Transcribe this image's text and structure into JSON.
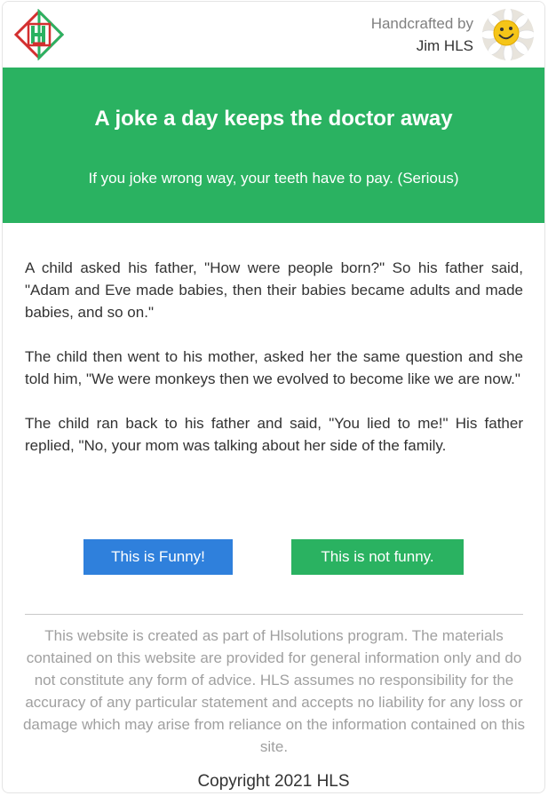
{
  "header": {
    "logo_icon": "hls-diamond-logo-icon",
    "credit_line1": "Handcrafted by",
    "credit_line2": "Jim HLS",
    "avatar_icon": "smiley-flower-avatar-icon"
  },
  "hero": {
    "title": "A joke a day keeps the doctor away",
    "subtitle": "If you joke wrong way, your teeth have to pay. (Serious)",
    "background_color": "#2ab261"
  },
  "joke": {
    "paragraphs": [
      "A child asked his father, \"How were people born?\" So his father said, \"Adam and Eve made babies, then their babies became adults and made babies, and so on.\"",
      "The child then went to his mother, asked her the same question and she told him, \"We were monkeys then we evolved to become like we are now.\"",
      "The child ran back to his father and said, \"You lied to me!\" His father replied, \"No, your mom was talking about her side of the family."
    ]
  },
  "buttons": {
    "funny_label": "This is Funny!",
    "funny_color": "#2f80dc",
    "not_funny_label": "This is not funny.",
    "not_funny_color": "#2ab261"
  },
  "footer": {
    "disclaimer": "This website is created as part of Hlsolutions program. The materials contained on this website are provided for general information only and do not constitute any form of advice. HLS assumes no responsibility for the accuracy of any particular statement and accepts no liability for any loss or damage which may arise from reliance on the information contained on this site.",
    "copyright": "Copyright 2021 HLS"
  }
}
